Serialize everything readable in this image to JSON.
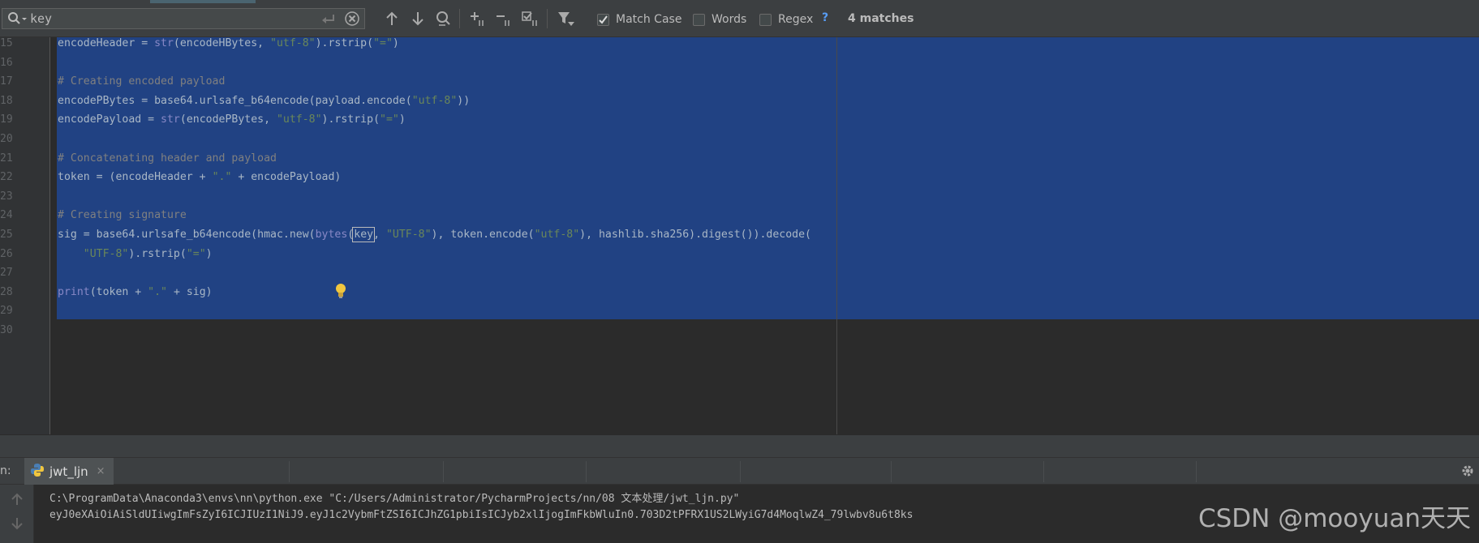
{
  "find": {
    "query": "key",
    "options": [
      {
        "id": "match_case",
        "label": "Match Case",
        "checked": true
      },
      {
        "id": "words",
        "label": "Words",
        "checked": false
      },
      {
        "id": "regex",
        "label": "Regex",
        "checked": false
      }
    ],
    "help": "?",
    "matches": "4 matches"
  },
  "editor": {
    "lines": [
      {
        "n": "15",
        "code": [
          [
            "encodeHeader = ",
            ""
          ],
          [
            "str",
            "builtin"
          ],
          [
            "(encodeHBytes, ",
            ""
          ],
          [
            "\"utf-8\"",
            "str"
          ],
          [
            ").rstrip(",
            ""
          ],
          [
            "\"=\"",
            "str"
          ],
          [
            ")",
            ""
          ]
        ]
      },
      {
        "n": "16",
        "code": []
      },
      {
        "n": "17",
        "code": [
          [
            "# Creating encoded payload",
            "comment"
          ]
        ]
      },
      {
        "n": "18",
        "code": [
          [
            "encodePBytes = base64.urlsafe_b64encode(payload.encode(",
            ""
          ],
          [
            "\"utf-8\"",
            "str"
          ],
          [
            "))",
            ""
          ]
        ]
      },
      {
        "n": "19",
        "code": [
          [
            "encodePayload = ",
            ""
          ],
          [
            "str",
            "builtin"
          ],
          [
            "(encodePBytes, ",
            ""
          ],
          [
            "\"utf-8\"",
            "str"
          ],
          [
            ").rstrip(",
            ""
          ],
          [
            "\"=\"",
            "str"
          ],
          [
            ")",
            ""
          ]
        ]
      },
      {
        "n": "20",
        "code": []
      },
      {
        "n": "21",
        "code": [
          [
            "# Concatenating header and payload",
            "comment"
          ]
        ]
      },
      {
        "n": "22",
        "code": [
          [
            "token = (encodeHeader + ",
            ""
          ],
          [
            "\".\"",
            "str"
          ],
          [
            " + encodePayload)",
            ""
          ]
        ]
      },
      {
        "n": "23",
        "code": []
      },
      {
        "n": "24",
        "code": [
          [
            "# Creating signature",
            "comment"
          ]
        ]
      },
      {
        "n": "25",
        "code": [
          [
            "sig = base64.urlsafe_b64encode(hmac.new(",
            ""
          ],
          [
            "bytes",
            "builtin"
          ],
          [
            "(",
            ""
          ],
          [
            "key",
            "match"
          ],
          [
            ", ",
            ""
          ],
          [
            "\"UTF-8\"",
            "str"
          ],
          [
            "), token.encode(",
            ""
          ],
          [
            "\"utf-8\"",
            "str"
          ],
          [
            "), hashlib.sha256).digest()).decode(",
            ""
          ]
        ]
      },
      {
        "n": "26",
        "code": [
          [
            "    ",
            ""
          ],
          [
            "\"UTF-8\"",
            "str"
          ],
          [
            ").rstrip(",
            ""
          ],
          [
            "\"=\"",
            "str"
          ],
          [
            ")",
            ""
          ]
        ]
      },
      {
        "n": "27",
        "code": []
      },
      {
        "n": "28",
        "code": [
          [
            "print",
            "builtin"
          ],
          [
            "(token + ",
            ""
          ],
          [
            "\".\"",
            "str"
          ],
          [
            " + sig)",
            ""
          ]
        ]
      },
      {
        "n": "29",
        "code": []
      },
      {
        "n": "30",
        "code": []
      }
    ]
  },
  "run": {
    "label": "n:",
    "tab_label": "jwt_ljn",
    "tab_close": "×",
    "console": [
      "C:\\ProgramData\\Anaconda3\\envs\\nn\\python.exe \"C:/Users/Administrator/PycharmProjects/nn/08 文本处理/jwt_ljn.py\"",
      "eyJ0eXAiOiAiSldUIiwgImFsZyI6ICJIUzI1NiJ9.eyJ1c2VybmFtZSI6ICJhZG1pbiIsICJyb2xlIjogImFkbWluIn0.703D2tPFRX1US2LWyiG7d4MoqlwZ4_79lwbv8u6t8ks"
    ]
  },
  "watermark": "CSDN @mooyuan天天",
  "colors": {
    "selection": "#214283",
    "editor_bg": "#2b2b2b",
    "toolbar_bg": "#3c3f41",
    "string": "#6a8759",
    "comment": "#808080",
    "builtin": "#8888c6",
    "accent": "#589df6"
  }
}
